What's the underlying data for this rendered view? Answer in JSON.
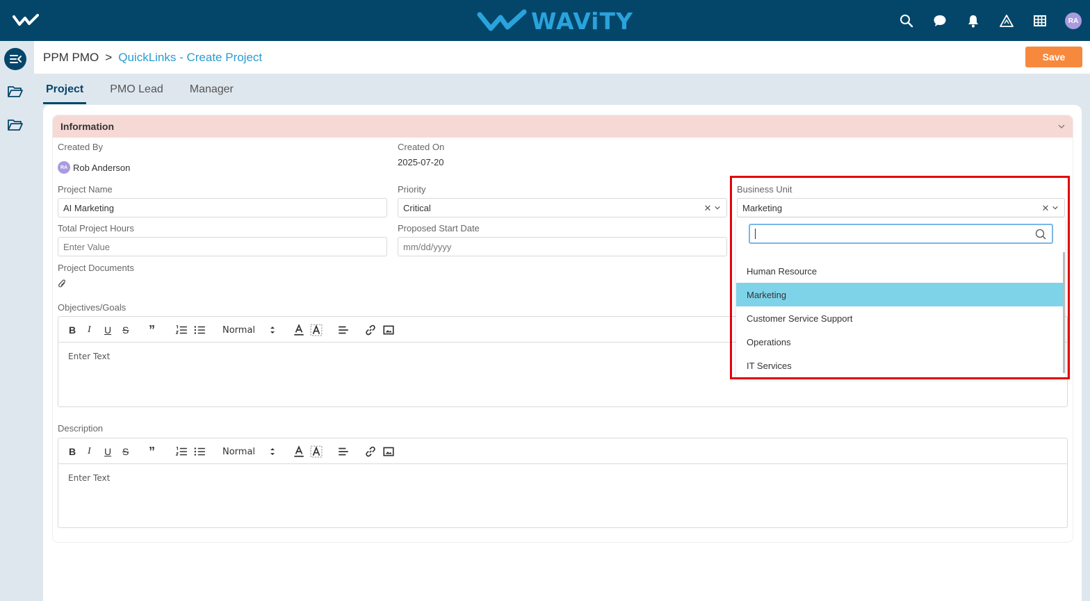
{
  "brand": {
    "name": "WAViTY",
    "user_initials": "RA"
  },
  "breadcrumb": {
    "parent": "PPM PMO",
    "separator": ">",
    "current": "QuickLinks - Create Project"
  },
  "actions": {
    "save": "Save"
  },
  "tabs": [
    {
      "label": "Project",
      "active": true
    },
    {
      "label": "PMO Lead",
      "active": false
    },
    {
      "label": "Manager",
      "active": false
    }
  ],
  "section": {
    "title": "Information"
  },
  "form": {
    "created_by": {
      "label": "Created By",
      "initials": "RA",
      "value": "Rob Anderson"
    },
    "created_on": {
      "label": "Created On",
      "value": "2025-07-20"
    },
    "project_name": {
      "label": "Project Name",
      "value": "AI Marketing"
    },
    "priority": {
      "label": "Priority",
      "value": "Critical"
    },
    "business_unit": {
      "label": "Business Unit",
      "value": "Marketing"
    },
    "total_hours": {
      "label": "Total Project Hours",
      "placeholder": "Enter Value"
    },
    "start_date": {
      "label": "Proposed Start Date",
      "placeholder": "mm/dd/yyyy"
    },
    "documents": {
      "label": "Project Documents"
    },
    "objectives": {
      "label": "Objectives/Goals",
      "format": "Normal",
      "placeholder": "Enter Text"
    },
    "description": {
      "label": "Description",
      "format": "Normal",
      "placeholder": "Enter Text"
    }
  },
  "dropdown": {
    "search_value": "",
    "options": [
      {
        "label": "Human Resource",
        "selected": false
      },
      {
        "label": "Marketing",
        "selected": true
      },
      {
        "label": "Customer Service Support",
        "selected": false
      },
      {
        "label": "Operations",
        "selected": false
      },
      {
        "label": "IT Services",
        "selected": false
      }
    ]
  },
  "colors": {
    "topbar": "#04466a",
    "accent": "#2a9bd2",
    "save": "#f7893e",
    "section_header": "#f6d9d5",
    "selected_option": "#7fd3e9",
    "highlight": "#e3000f"
  },
  "icons": [
    "home-logo-icon",
    "search-icon",
    "chat-icon",
    "bell-icon",
    "triangle-icon",
    "grid-icon",
    "collapse-menu-icon",
    "folder-icon",
    "chevron-down-icon",
    "clear-icon",
    "paperclip-icon",
    "bold-icon",
    "italic-icon",
    "underline-icon",
    "strike-icon",
    "quote-icon",
    "ordered-list-icon",
    "bullet-list-icon",
    "font-color-icon",
    "highlight-color-icon",
    "align-icon",
    "link-icon",
    "image-icon"
  ]
}
